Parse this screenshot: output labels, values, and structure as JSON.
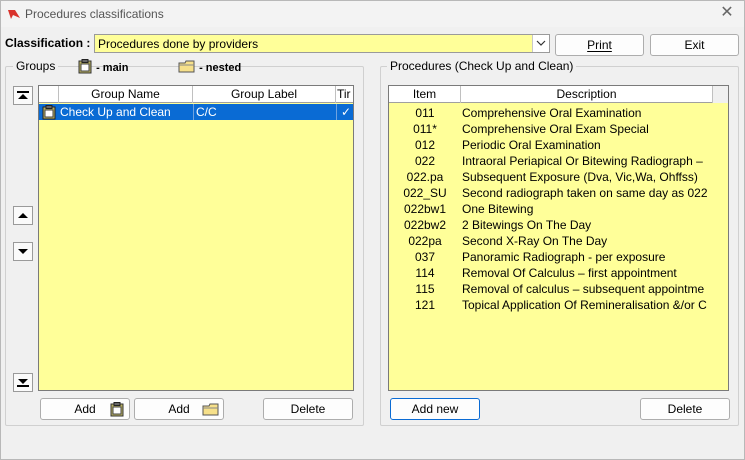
{
  "window": {
    "title": "Procedures classifications"
  },
  "classification": {
    "label": "Classification :",
    "value": "Procedures done by providers"
  },
  "buttons": {
    "print": "Print",
    "exit": "Exit",
    "add_main": "Add",
    "add_nested": "Add",
    "delete_group": "Delete",
    "add_new": "Add new",
    "delete_proc": "Delete"
  },
  "groups": {
    "title": "Groups",
    "legend_main": "- main",
    "legend_nested": "- nested",
    "columns": [
      "Group Name",
      "Group Label",
      "Tir"
    ],
    "rows": [
      {
        "name": "Check Up and Clean",
        "label": "C/C",
        "tick": "✓"
      }
    ]
  },
  "procedures": {
    "title": "Procedures (Check Up and Clean)",
    "columns": [
      "Item",
      "Description"
    ],
    "rows": [
      {
        "item": "011",
        "desc": "Comprehensive Oral Examination"
      },
      {
        "item": "011*",
        "desc": "Comprehensive Oral Exam Special"
      },
      {
        "item": "012",
        "desc": "Periodic Oral Examination"
      },
      {
        "item": "022",
        "desc": "Intraoral Periapical Or Bitewing Radiograph –"
      },
      {
        "item": "022.pa",
        "desc": "Subsequent Exposure (Dva, Vic,Wa, Ohffss)"
      },
      {
        "item": "022_SU",
        "desc": "Second radiograph taken on same day as 022"
      },
      {
        "item": "022bw1",
        "desc": "One Bitewing"
      },
      {
        "item": "022bw2",
        "desc": "2 Bitewings On The Day"
      },
      {
        "item": "022pa",
        "desc": "Second X-Ray On The Day"
      },
      {
        "item": "037",
        "desc": "Panoramic Radiograph - per exposure"
      },
      {
        "item": "114",
        "desc": "Removal Of Calculus – first appointment"
      },
      {
        "item": "115",
        "desc": "Removal of calculus – subsequent appointme"
      },
      {
        "item": "121",
        "desc": "Topical Application Of Remineralisation &/or C"
      }
    ]
  },
  "colors": {
    "field_yellow": "#ffff99",
    "selection": "#0a6bd4"
  }
}
